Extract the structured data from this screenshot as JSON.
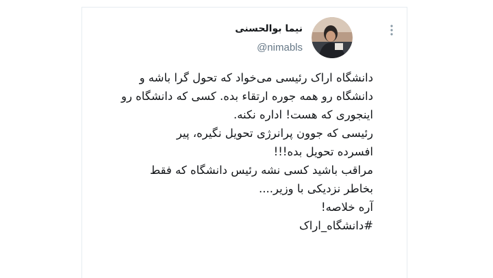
{
  "tweet": {
    "author": {
      "display_name": "نیما بوالحسنی",
      "handle": "@nimabls"
    },
    "body_lines": [
      "دانشگاه اراک رئیسی می‌خواد که تحول گرا باشه و",
      "دانشگاه رو همه جوره ارتقاء بده. کسی که دانشگاه رو",
      "اینجوری که هست! اداره نکنه.",
      "رئیسی که جوون پرانرژی تحویل نگیره، پیر",
      "افسرده تحویل بده!!!",
      "مراقب باشید کسی نشه رئیس دانشگاه که فقط",
      "بخاطر نزدیکی با وزیر....",
      "آره خلاصه!"
    ],
    "hashtag": "#دانشگاه_اراک"
  },
  "icons": {
    "more": "more-vertical-icon",
    "avatar": "user-avatar"
  },
  "colors": {
    "text": "#14171a",
    "secondary_text": "#657786",
    "border": "#e6ecf0"
  }
}
